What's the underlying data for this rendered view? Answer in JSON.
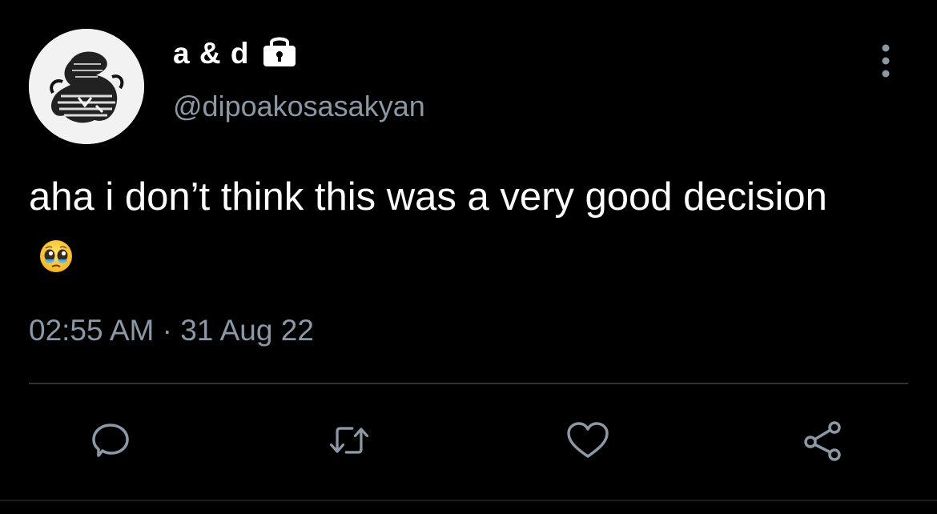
{
  "author": {
    "display_name": "a & d",
    "handle": "@dipoakosasakyan",
    "locked": true,
    "avatar": "abstract-black-white-scribble-avatar"
  },
  "tweet": {
    "text": "aha i don’t think this was a very good decision",
    "emoji": "pleading-face-with-tears",
    "timestamp": "02:55 AM",
    "separator": "·",
    "date": "31 Aug 22"
  },
  "actions": [
    {
      "icon": "reply-icon"
    },
    {
      "icon": "retweet-icon"
    },
    {
      "icon": "like-icon"
    },
    {
      "icon": "share-icon"
    }
  ],
  "colors": {
    "background": "#000000",
    "text": "#ffffff",
    "secondary": "#8b98a5",
    "divider": "#2f3336"
  }
}
